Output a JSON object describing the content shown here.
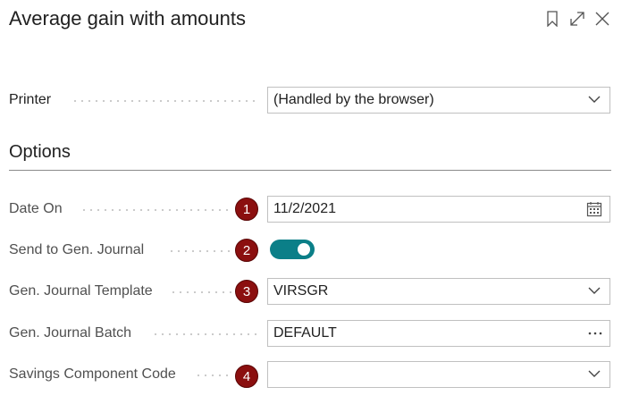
{
  "header": {
    "title": "Average gain with amounts",
    "icons": [
      "bookmark-icon",
      "expand-icon",
      "close-icon"
    ]
  },
  "printer": {
    "label": "Printer",
    "value": "(Handled by the browser)"
  },
  "options": {
    "heading": "Options",
    "fields": [
      {
        "label": "Date On",
        "value": "11/2/2021",
        "badge": "1"
      },
      {
        "label": "Send to Gen. Journal",
        "value": "on",
        "badge": "2"
      },
      {
        "label": "Gen. Journal Template",
        "value": "VIRSGR",
        "badge": "3"
      },
      {
        "label": "Gen. Journal Batch",
        "value": "DEFAULT"
      },
      {
        "label": "Savings Component Code",
        "value": "",
        "badge": "4"
      }
    ]
  },
  "colors": {
    "accent": "#0b7f88",
    "badge": "#8b0f0f"
  }
}
